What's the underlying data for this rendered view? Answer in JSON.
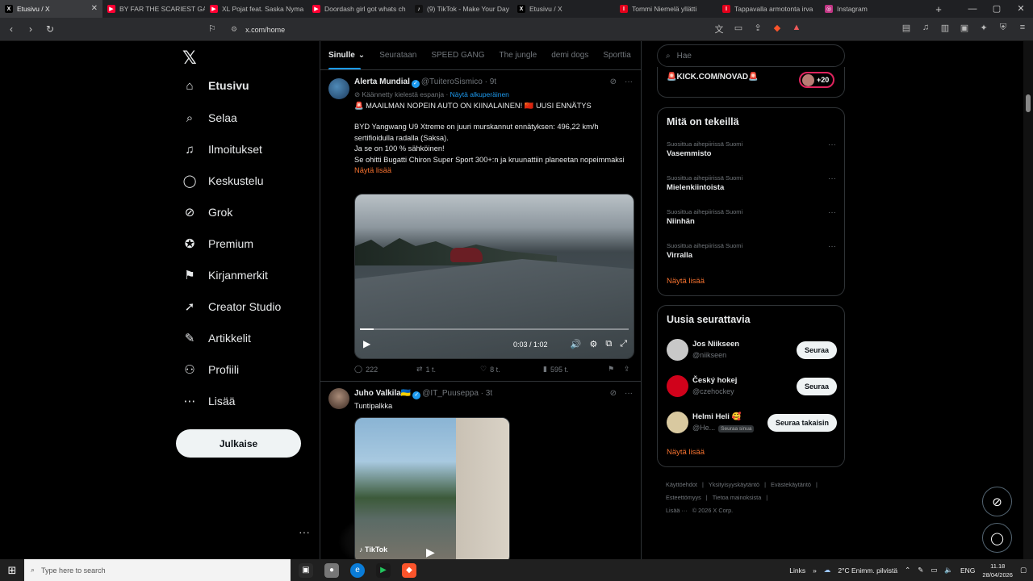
{
  "browser": {
    "tabs": [
      {
        "title": "Etusivu / X",
        "fav": "X",
        "fav_color": "#000000",
        "active": true
      },
      {
        "title": "BY FAR THE SCARIEST GAM",
        "fav": "▶",
        "fav_color": "#ff0033"
      },
      {
        "title": "XL Pojat feat. Saska Nyma",
        "fav": "▶",
        "fav_color": "#ff0033"
      },
      {
        "title": "Doordash girl got whats ch",
        "fav": "▶",
        "fav_color": "#ff0033"
      },
      {
        "title": "(9) TikTok - Make Your Day",
        "fav": "♪",
        "fav_color": "#111111"
      },
      {
        "title": "Etusivu / X",
        "fav": "X",
        "fav_color": "#000000"
      },
      {
        "title": "Tommi Niemelä yllätti",
        "fav": "I",
        "fav_color": "#e3001b"
      },
      {
        "title": "Tappavalla armotonta irva",
        "fav": "I",
        "fav_color": "#e3001b"
      },
      {
        "title": "Instagram",
        "fav": "◎",
        "fav_color": "#c13584"
      }
    ],
    "url": "x.com/home"
  },
  "nav": {
    "items": [
      {
        "label": "Etusivu",
        "icon": "home-icon",
        "glyph": "⌂",
        "bold": true
      },
      {
        "label": "Selaa",
        "icon": "search-icon",
        "glyph": "⌕"
      },
      {
        "label": "Ilmoitukset",
        "icon": "bell-icon",
        "glyph": "♫"
      },
      {
        "label": "Keskustelu",
        "icon": "chat-icon",
        "glyph": "◯"
      },
      {
        "label": "Grok",
        "icon": "grok-icon",
        "glyph": "⊘"
      },
      {
        "label": "Premium",
        "icon": "premium-icon",
        "glyph": "✪"
      },
      {
        "label": "Kirjanmerkit",
        "icon": "bookmark-icon",
        "glyph": "⚑"
      },
      {
        "label": "Creator Studio",
        "icon": "rocket-icon",
        "glyph": "➚"
      },
      {
        "label": "Artikkelit",
        "icon": "article-icon",
        "glyph": "✎"
      },
      {
        "label": "Profiili",
        "icon": "profile-icon",
        "glyph": "⚇"
      },
      {
        "label": "Lisää",
        "icon": "more-icon",
        "glyph": "⋯"
      }
    ],
    "post_label": "Julkaise"
  },
  "timeline": {
    "tabs": [
      "Sinulle",
      "Seurataan",
      "SPEED GANG",
      "The jungle",
      "demi dogs",
      "Sporttia"
    ],
    "tweet1": {
      "name": "Alerta Mundial",
      "handle": "@TuiteroSismico",
      "time": "9t",
      "translated": "Käännetty kielestä espanja",
      "show_original": "Näytä alkuperäinen",
      "line1": "🚨 MAAILMAN NOPEIN AUTO ON KIINALAINEN! 🇨🇳 UUSI ENNÄTYS",
      "line2": "BYD Yangwang U9 Xtreme on juuri murskannut ennätyksen: 496,22 km/h sertifioidulla radalla (Saksa).",
      "line3": "Ja se on 100 % sähköinen!",
      "line4": "Se ohitti Bugatti Chiron Super Sport 300+:n ja kruunattiin planeetan nopeimmaksi",
      "show_more": "Näytä lisää",
      "video_time": "0:03 / 1:02",
      "video_progress": 0.05,
      "replies": "222",
      "reposts": "1 t.",
      "likes": "8 t.",
      "views": "595 t."
    },
    "tweet2": {
      "name": "Juho Valkila🇺🇦",
      "handle": "@IT_Puuseppa",
      "time": "3t",
      "text": "Tuntipalkka",
      "tiktok": "TikTok"
    }
  },
  "sidebar": {
    "search_placeholder": "Hae",
    "live_title": "🚨KICK.COM/NOVAD🚨",
    "live_count": "+20",
    "trends_title": "Mitä on tekeillä",
    "trends": [
      {
        "context": "Suosittua aihepiirissä Suomi",
        "name": "Vasemmisto"
      },
      {
        "context": "Suosittua aihepiirissä Suomi",
        "name": "Mielenkiintoista"
      },
      {
        "context": "Suosittua aihepiirissä Suomi",
        "name": "Niinhän"
      },
      {
        "context": "Suosittua aihepiirissä Suomi",
        "name": "Virralla"
      }
    ],
    "trends_more": "Näytä lisää",
    "who_title": "Uusia seurattavia",
    "who": [
      {
        "name": "Jos Niikseen",
        "handle": "@niikseen",
        "button": "Seuraa",
        "avatar_color": "#c8c8c8"
      },
      {
        "name": "Český hokej",
        "handle": "@czehockey",
        "button": "Seuraa",
        "avatar_color": "#d0021b"
      },
      {
        "name": "Helmi Heli 🥰",
        "handle": "@He...",
        "follows_you": "Seuraa sinua",
        "button": "Seuraa takaisin",
        "avatar_color": "#d9c9a0"
      }
    ],
    "who_more": "Näytä lisää",
    "footer": [
      "Käyttöehdot",
      "|",
      "Yksityisyyskäytäntö",
      "|",
      "Evästekäytäntö",
      "|",
      "Esteettömyys",
      "|",
      "Tietoa mainoksista",
      "|",
      "Lisää ···",
      "© 2026 X Corp."
    ]
  },
  "taskbar": {
    "search_placeholder": "Type here to search",
    "links": "Links",
    "weather": "2°C  Enimm. pilvistä",
    "lang": "ENG",
    "time": "11.18",
    "date": "28/04/2026"
  }
}
